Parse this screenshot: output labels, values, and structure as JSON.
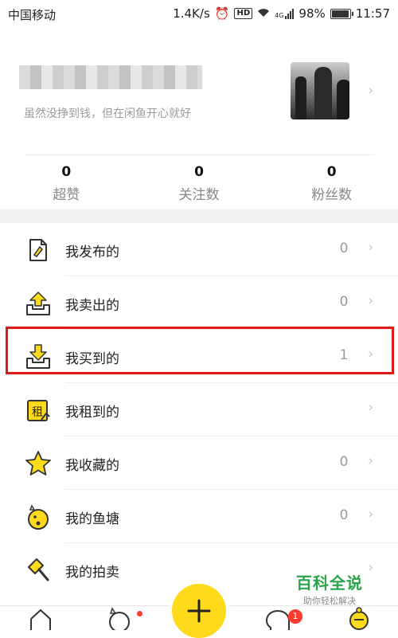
{
  "status_bar": {
    "carrier": "中国移动",
    "speed": "1.4K/s",
    "hd": "HD",
    "network": "4G",
    "battery": "98%",
    "battery_level": 0.98,
    "time": "11:57"
  },
  "profile": {
    "nickname": "",
    "slogan": "虽然没挣到钱，但在闲鱼开心就好"
  },
  "stats": [
    {
      "value": "0",
      "label": "超赞"
    },
    {
      "value": "0",
      "label": "关注数"
    },
    {
      "value": "0",
      "label": "粉丝数"
    }
  ],
  "menu": [
    {
      "label": "我发布的",
      "count": "0",
      "icon": "publish-icon"
    },
    {
      "label": "我卖出的",
      "count": "0",
      "icon": "sold-icon"
    },
    {
      "label": "我买到的",
      "count": "1",
      "icon": "bought-icon"
    },
    {
      "label": "我租到的",
      "count": "",
      "icon": "rent-icon",
      "icon_text": "租"
    },
    {
      "label": "我收藏的",
      "count": "0",
      "icon": "star-icon"
    },
    {
      "label": "我的鱼塘",
      "count": "0",
      "icon": "fishpond-icon"
    },
    {
      "label": "我的拍卖",
      "count": "",
      "icon": "auction-icon"
    }
  ],
  "tabbar": {
    "message_badge": "1"
  },
  "watermark": {
    "title": "百科全说",
    "subtitle": "助你轻松解决"
  },
  "colors": {
    "accent": "#ffda1a",
    "highlight": "#e0191b",
    "badge": "#ff3b30"
  }
}
